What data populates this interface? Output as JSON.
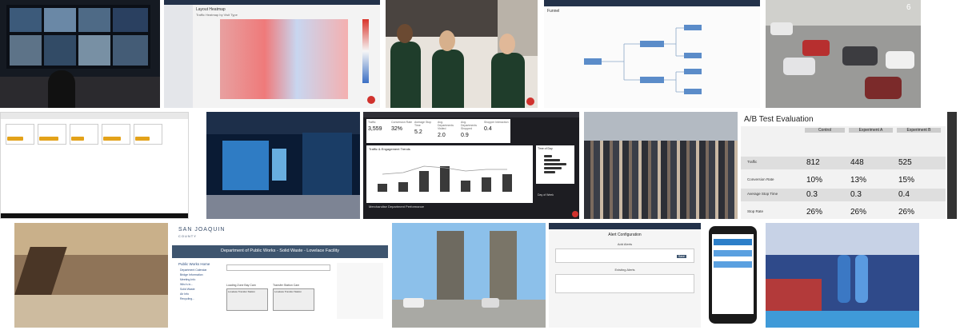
{
  "row1": {
    "heatmap": {
      "title": "Layout Heatmap",
      "subtitle": "Traffic Heatmap by Visit Type"
    },
    "funnel": {
      "title": "Funnel"
    },
    "camera_badge": "6"
  },
  "row2": {
    "dashboard": {
      "kpis": [
        {
          "label": "Traffic",
          "value": "3,559"
        },
        {
          "label": "Conversion Rate",
          "value": "32%"
        },
        {
          "label": "Average Stop Time",
          "value": "5.2"
        },
        {
          "label": "Avg. Departments Visited",
          "value": "2.0"
        },
        {
          "label": "Avg. Departments Shopped",
          "value": "0.9"
        },
        {
          "label": "Shopper Interaction",
          "value": "0.4"
        }
      ],
      "trends_title": "Traffic & Engagement Trends",
      "dept_title": "Merchandise Department Performance",
      "time_of_day": "Time of Day",
      "day_of_week": "Day of Week"
    },
    "ab_test": {
      "title": "A/B Test Evaluation",
      "columns": [
        "Control",
        "Experiment A",
        "Experiment B"
      ],
      "rows": [
        {
          "label": "Traffic",
          "values": [
            "812",
            "448",
            "525"
          ]
        },
        {
          "label": "Conversion Rate",
          "values": [
            "10%",
            "13%",
            "15%"
          ]
        },
        {
          "label": "Average Stop Time",
          "values": [
            "0.3",
            "0.3",
            "0.4"
          ]
        },
        {
          "label": "Stop Rate",
          "values": [
            "26%",
            "26%",
            "26%"
          ]
        }
      ]
    }
  },
  "row3": {
    "sanjoaquin": {
      "logo": "SAN JOAQUIN",
      "logo_sub": "COUNTY",
      "banner": "Department of Public Works - Solid Waste - Lovelace Facility",
      "sidebar_title": "Public Works Home",
      "sidebar_items": [
        "Department Calendar",
        "Bridge Information",
        "Meeting Info",
        "Who's in...",
        "Solid Waste",
        "Air Info",
        "Recycling..."
      ],
      "cams": [
        "Loading Zone Bay Cam",
        "Transfer Station Cam"
      ],
      "cam_captions": [
        "Lovelace Transfer Station",
        "Lovelace Transfer Station"
      ]
    },
    "alerts": {
      "title": "Alert Configuration",
      "add_title": "Add Alerts",
      "existing_title": "Existing Alerts",
      "save": "Save"
    }
  }
}
